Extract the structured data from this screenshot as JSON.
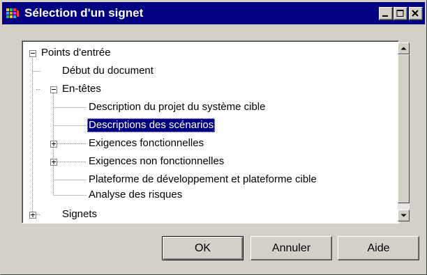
{
  "window": {
    "title": "Sélection d'un signet",
    "icon": "app-icon",
    "controls": [
      "minimize-icon",
      "maximize-icon",
      "close-icon"
    ]
  },
  "tree": {
    "nodes": [
      {
        "label": "Points d'entrée",
        "expander": "minus"
      },
      {
        "label": "Début du document"
      },
      {
        "label": "En-têtes",
        "expander": "minus"
      },
      {
        "label": "Description du projet du système cible"
      },
      {
        "label": "Descriptions des scénarios",
        "selected": true
      },
      {
        "label": "Exigences fonctionnelles",
        "expander": "plus"
      },
      {
        "label": "Exigences non fonctionnelles",
        "expander": "plus"
      },
      {
        "label": "Plateforme de développement et plateforme cible"
      },
      {
        "label": "Analyse des risques"
      },
      {
        "label": "Signets",
        "expander": "plus"
      }
    ]
  },
  "buttons": {
    "ok": "OK",
    "cancel": "Annuler",
    "help": "Aide"
  },
  "colors": {
    "titlebar": "#000080",
    "face": "#d4d0c8",
    "selection": "#000080"
  }
}
